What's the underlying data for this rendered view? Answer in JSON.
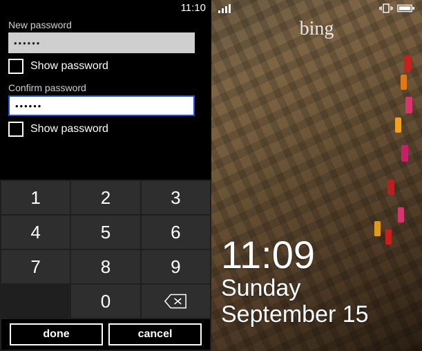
{
  "left": {
    "statusTime": "11:10",
    "newPassword": {
      "label": "New password",
      "value": "••••••",
      "showLabel": "Show password"
    },
    "confirmPassword": {
      "label": "Confirm password",
      "value": "••••••",
      "showLabel": "Show password"
    },
    "keypad": {
      "keys": [
        "1",
        "2",
        "3",
        "4",
        "5",
        "6",
        "7",
        "8",
        "9",
        "",
        "0",
        "⌫"
      ]
    },
    "actions": {
      "done": "done",
      "cancel": "cancel"
    }
  },
  "right": {
    "logo": "bing",
    "time": "11:09",
    "dayOfWeek": "Sunday",
    "date": "September 15"
  }
}
